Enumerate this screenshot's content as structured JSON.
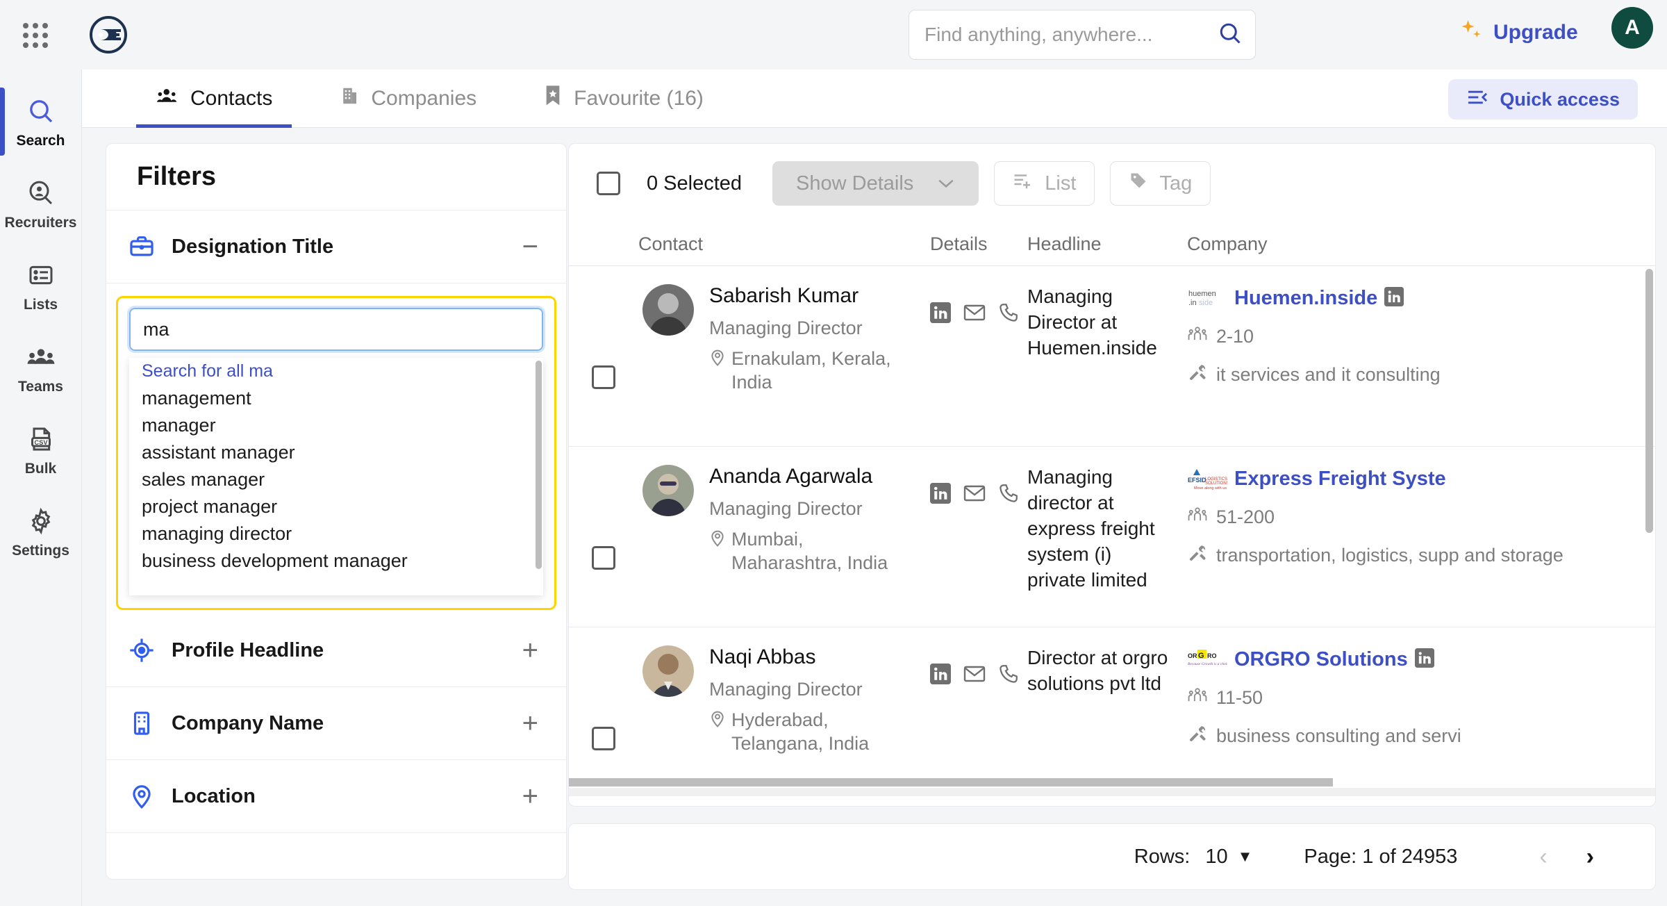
{
  "header": {
    "grid_menu_icon": "apps-grid-icon",
    "logo_icon": "brand-logo-icon",
    "search": {
      "value": "",
      "placeholder": "Find anything, anywhere...",
      "icon": "search-icon"
    },
    "upgrade_label": "Upgrade",
    "upgrade_icon": "sparkle-icon",
    "avatar_initial": "A",
    "accent_blue": "#3d4fc4",
    "avatar_bg": "#0f4b3e"
  },
  "rail": {
    "items": [
      {
        "label": "Search",
        "icon": "search-icon",
        "active": true
      },
      {
        "label": "Recruiters",
        "icon": "recruiter-search-icon",
        "active": false
      },
      {
        "label": "Lists",
        "icon": "list-icon",
        "active": false
      },
      {
        "label": "Teams",
        "icon": "teams-icon",
        "active": false
      },
      {
        "label": "Bulk",
        "icon": "csv-file-icon",
        "active": false
      },
      {
        "label": "Settings",
        "icon": "gear-icon",
        "active": false
      }
    ]
  },
  "tabs": {
    "items": [
      {
        "label": "Contacts",
        "icon": "people-icon",
        "active": true
      },
      {
        "label": "Companies",
        "icon": "building-icon",
        "active": false
      },
      {
        "label": "Favourite (16)",
        "icon": "bookmark-star-icon",
        "active": false
      }
    ],
    "quick_access_label": "Quick access",
    "quick_access_icon": "collapse-panel-icon"
  },
  "filters": {
    "title": "Filters",
    "designation": {
      "label": "Designation Title",
      "icon": "briefcase-icon",
      "toggle": "−",
      "input_value": "ma",
      "input_placeholder": "",
      "suggestions": [
        "Search for all ma",
        "management",
        "manager",
        "assistant manager",
        "sales manager",
        "project manager",
        "managing director",
        "business development manager"
      ]
    },
    "rows": [
      {
        "label": "Profile Headline",
        "icon": "target-icon",
        "toggle": "+"
      },
      {
        "label": "Company Name",
        "icon": "building-icon",
        "toggle": "+"
      },
      {
        "label": "Location",
        "icon": "location-icon",
        "toggle": "+"
      }
    ]
  },
  "results": {
    "toolbar": {
      "selected_label": "0 Selected",
      "show_details_label": "Show Details",
      "show_details_icon": "chevron-down-icon",
      "list_label": "List",
      "list_icon": "add-to-list-icon",
      "tag_label": "Tag",
      "tag_icon": "tag-icon"
    },
    "columns": [
      "Contact",
      "Details",
      "Headline",
      "Company"
    ],
    "rows": [
      {
        "name": "Sabarish Kumar",
        "role": "Managing Director",
        "location": "Ernakulam, Kerala, India",
        "headline": "Managing Director at Huemen.inside",
        "company_name": "Huemen.inside",
        "company_logo_text": "huemen .inside",
        "company_size": "2-10",
        "company_industry": "it services and it consulting",
        "detail_icons": [
          "linkedin-icon",
          "email-icon",
          "phone-icon"
        ],
        "photo_tone": "#8d8d8d"
      },
      {
        "name": "Ananda Agarwala",
        "role": "Managing Director",
        "location": "Mumbai, Maharashtra, India",
        "headline": "Managing director at express freight system (i) private limited",
        "company_name": "Express Freight Syste",
        "company_logo_text": "EFS",
        "company_size": "51-200",
        "company_industry": "transportation, logistics, supp and storage",
        "detail_icons": [
          "linkedin-icon",
          "email-icon",
          "phone-icon"
        ],
        "photo_tone": "#9aa08f"
      },
      {
        "name": "Naqi Abbas",
        "role": "Managing Director",
        "location": "Hyderabad, Telangana, India",
        "headline": "Director at orgro solutions pvt ltd",
        "company_name": "ORGRO Solutions",
        "company_logo_text": "ORGRO",
        "company_size": "11-50",
        "company_industry": "business consulting and servi",
        "detail_icons": [
          "linkedin-icon",
          "email-icon",
          "phone-icon"
        ],
        "photo_tone": "#b09a82"
      }
    ]
  },
  "pagination": {
    "rows_label": "Rows:",
    "rows_value": "10",
    "rows_caret": "▼",
    "page_label": "Page: 1 of 24953",
    "prev_icon": "chevron-left-icon",
    "next_icon": "chevron-right-icon"
  }
}
